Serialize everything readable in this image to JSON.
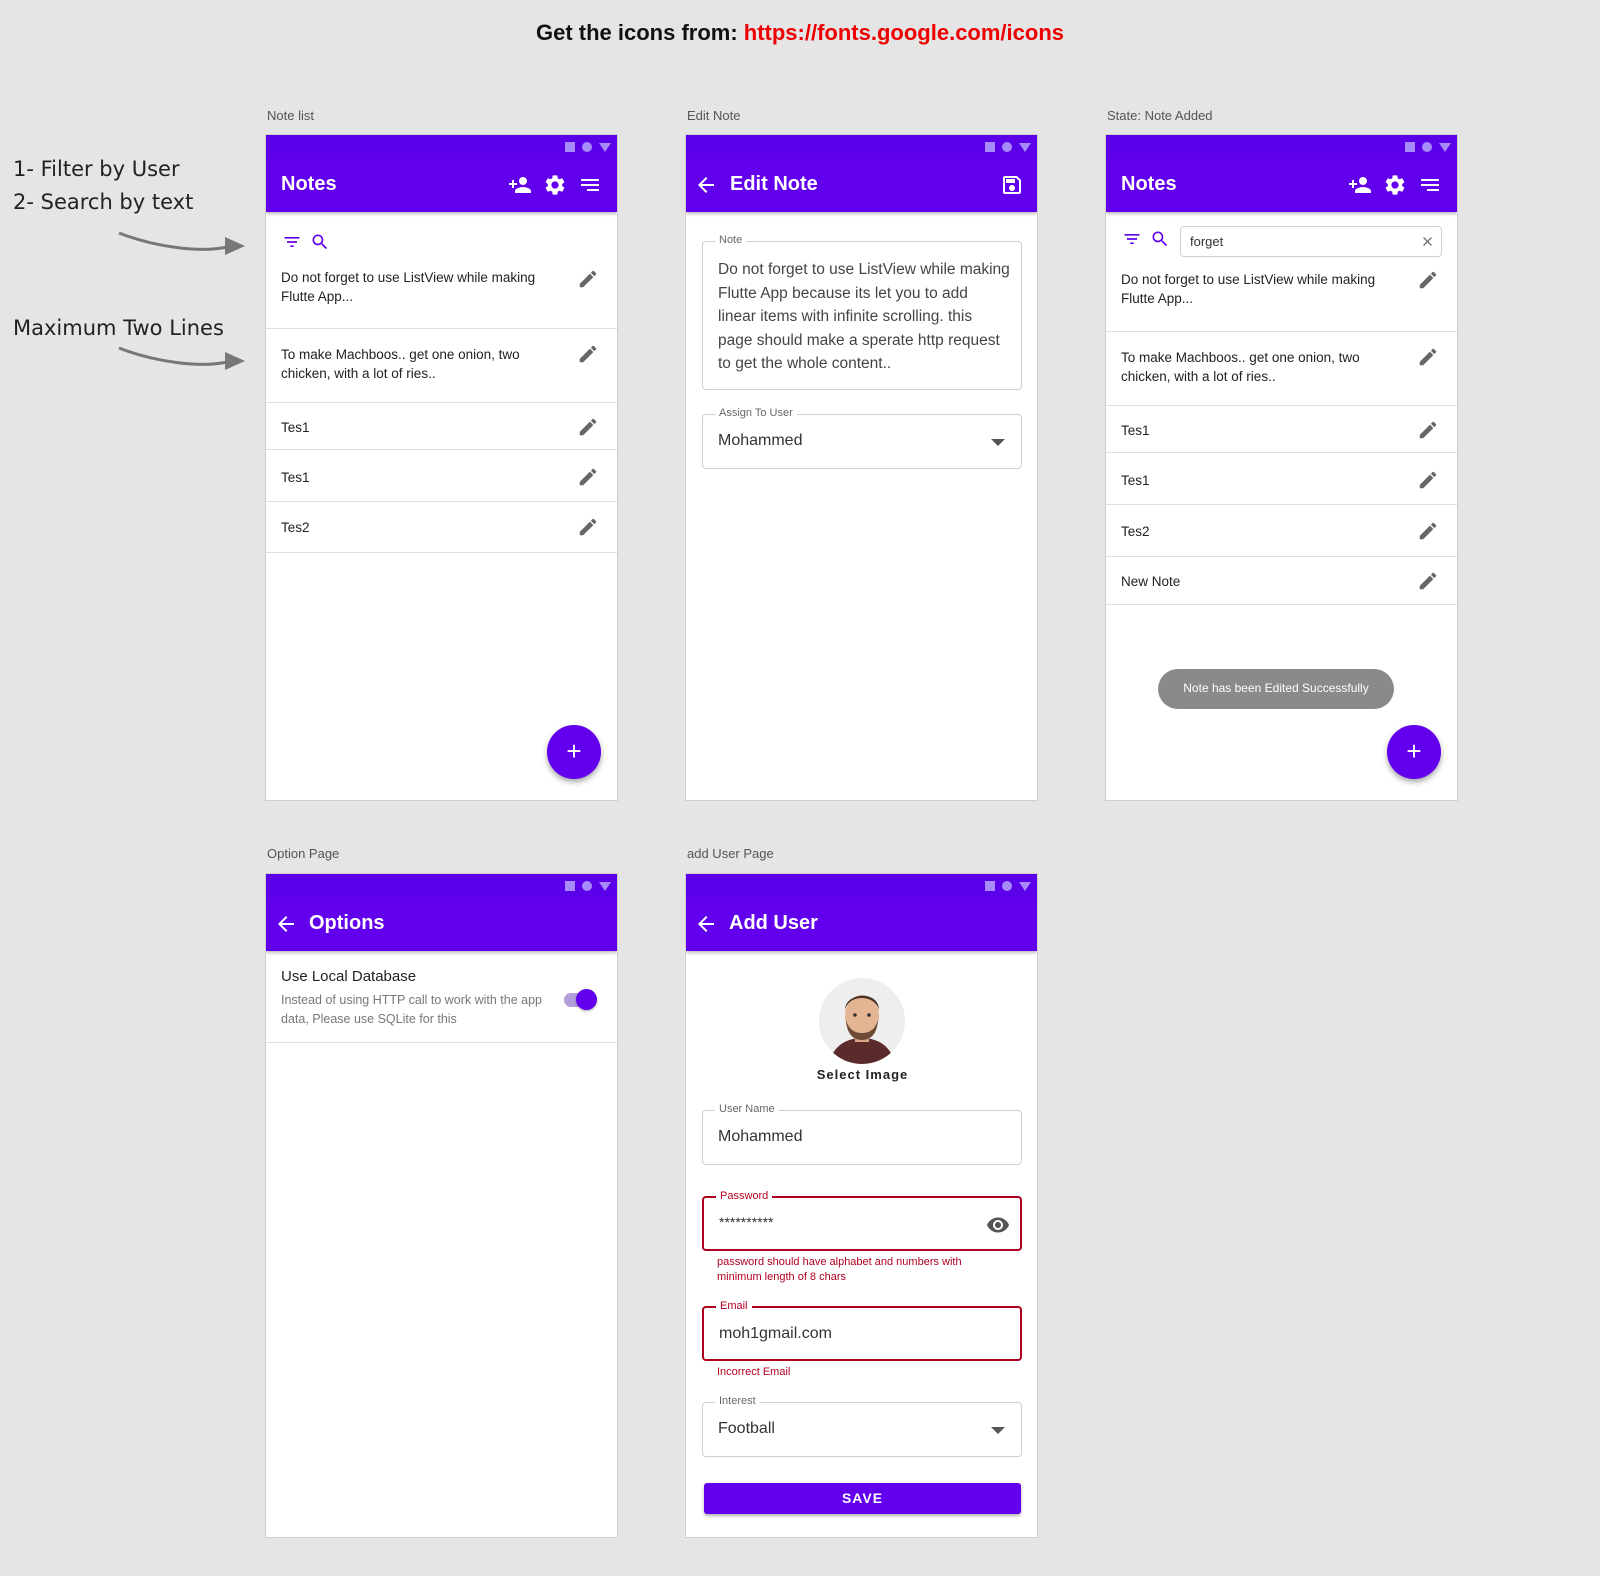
{
  "top_note": {
    "prefix": "Get the icons from: ",
    "link": "https://fonts.google.com/icons"
  },
  "annotations": {
    "filter": "1- Filter by User",
    "search": "2- Search by text",
    "max_lines": "Maximum Two Lines"
  },
  "frames": {
    "note_list": "Note list",
    "edit_note": "Edit Note",
    "note_added": "State: Note Added",
    "option_page": "Option Page",
    "add_user_page": "add User Page"
  },
  "note_list": {
    "title": "Notes",
    "items": [
      {
        "text": "Do not forget to use ListView while making Flutte App..."
      },
      {
        "text": "To make Machboos.. get one onion, two chicken, with a lot of ries.."
      },
      {
        "text": "Tes1"
      },
      {
        "text": "Tes1"
      },
      {
        "text": "Tes2"
      }
    ],
    "fab": "+"
  },
  "edit_note": {
    "title": "Edit Note",
    "note_label": "Note",
    "note_value": "Do not forget to use ListView while making Flutte App because its let you to add linear items with infinite scrolling. this page should make a sperate http request to get the whole content..",
    "assign_label": "Assign To User",
    "assign_value": "Mohammed"
  },
  "note_added": {
    "title": "Notes",
    "search_value": "forget",
    "items": [
      {
        "text": "Do not forget to use ListView while making Flutte App..."
      },
      {
        "text": "To make Machboos.. get one onion, two chicken, with a lot of ries.."
      },
      {
        "text": "Tes1"
      },
      {
        "text": "Tes1"
      },
      {
        "text": "Tes2"
      },
      {
        "text": "New Note"
      }
    ],
    "toast": "Note has been Edited Successfully",
    "fab": "+"
  },
  "options": {
    "title": "Options",
    "setting_title": "Use Local Database",
    "setting_desc": "Instead of using HTTP call to work with the app data, Please use SQLite for this",
    "toggle_on": true
  },
  "add_user": {
    "title": "Add User",
    "select_image": "Select Image",
    "username_label": "User Name",
    "username_value": "Mohammed",
    "password_label": "Password",
    "password_value": "**********",
    "password_error": "password should have alphabet and numbers with minimum length of 8 chars",
    "email_label": "Email",
    "email_value": "moh1gmail.com",
    "email_error": "Incorrect Email",
    "interest_label": "Interest",
    "interest_value": "Football",
    "save_label": "SAVE"
  },
  "colors": {
    "primary": "#6200ee",
    "status": "#5b00e8",
    "error": "#b00020",
    "link": "#ee0000"
  }
}
